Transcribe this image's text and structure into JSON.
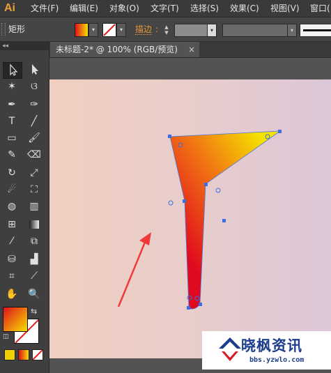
{
  "app": {
    "logo": "Ai"
  },
  "menubar": {
    "items": [
      "文件(F)",
      "编辑(E)",
      "对象(O)",
      "文字(T)",
      "选择(S)",
      "效果(C)",
      "视图(V)",
      "窗口("
    ]
  },
  "controlbar": {
    "tool_name": "矩形",
    "stroke_label": "描边",
    "stroke_colon": ":",
    "fill_icon": "gradient-swatch",
    "stroke_icon": "none-swatch"
  },
  "tabs": [
    {
      "title": "未标题-2* @ 100% (RGB/预览)",
      "close": "×"
    }
  ],
  "toolbox": {
    "collapse": "◂◂",
    "tools": [
      "selection-tool",
      "direct-selection-tool",
      "magic-wand-tool",
      "lasso-tool",
      "pen-tool",
      "curvature-tool",
      "type-tool",
      "line-tool",
      "rectangle-tool",
      "paintbrush-tool",
      "pencil-tool",
      "eraser-tool",
      "rotate-tool",
      "scale-tool",
      "warp-tool",
      "free-transform-tool",
      "shape-builder-tool",
      "perspective-grid-tool",
      "mesh-tool",
      "gradient-tool",
      "eyedropper-tool",
      "blend-tool",
      "symbol-sprayer-tool",
      "column-graph-tool",
      "artboard-tool",
      "slice-tool",
      "hand-tool",
      "zoom-tool"
    ],
    "fill_color": "#f07a10",
    "stroke": "none"
  },
  "artwork": {
    "shape_gradient_start": "#e00a1e",
    "shape_gradient_end": "#f6e200",
    "arrow_color": "#f03a3a",
    "anchor_color": "#3a6ee8"
  },
  "watermark": {
    "title": "晓枫资讯",
    "url": "bbs.yzwlo.com"
  }
}
